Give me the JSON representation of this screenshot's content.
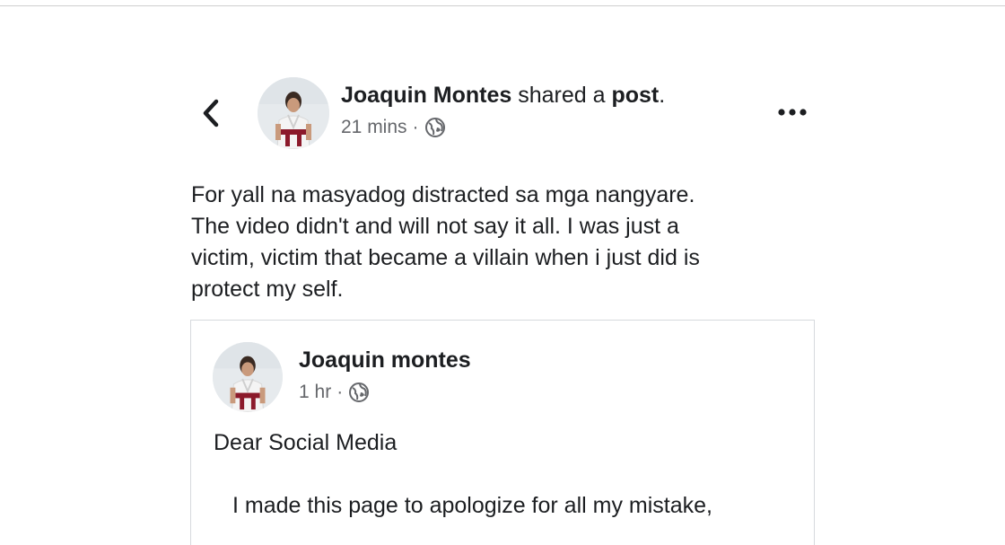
{
  "post": {
    "author": "Joaquin Montes",
    "action_text": " shared a ",
    "object_text": "post",
    "period": ".",
    "time": "21 mins",
    "separator": "·",
    "privacy_icon": "globe-icon",
    "back_icon": "chevron-left-icon",
    "more_icon": "more-horizontal-icon",
    "text": "For yall na masyadog distracted sa mga nangyare.\nThe video didn't and will not say it all. I was just a\nvictim, victim that became a villain when i just did is\nprotect my self."
  },
  "shared_post": {
    "author": "Joaquin montes",
    "time": "1 hr",
    "separator": "·",
    "privacy_icon": "globe-icon",
    "line1": "Dear Social Media",
    "line2": "I made this page to apologize for all my mistake,"
  },
  "colors": {
    "text": "#1c1e21",
    "meta": "#65676b",
    "border": "#d6d9dd"
  }
}
